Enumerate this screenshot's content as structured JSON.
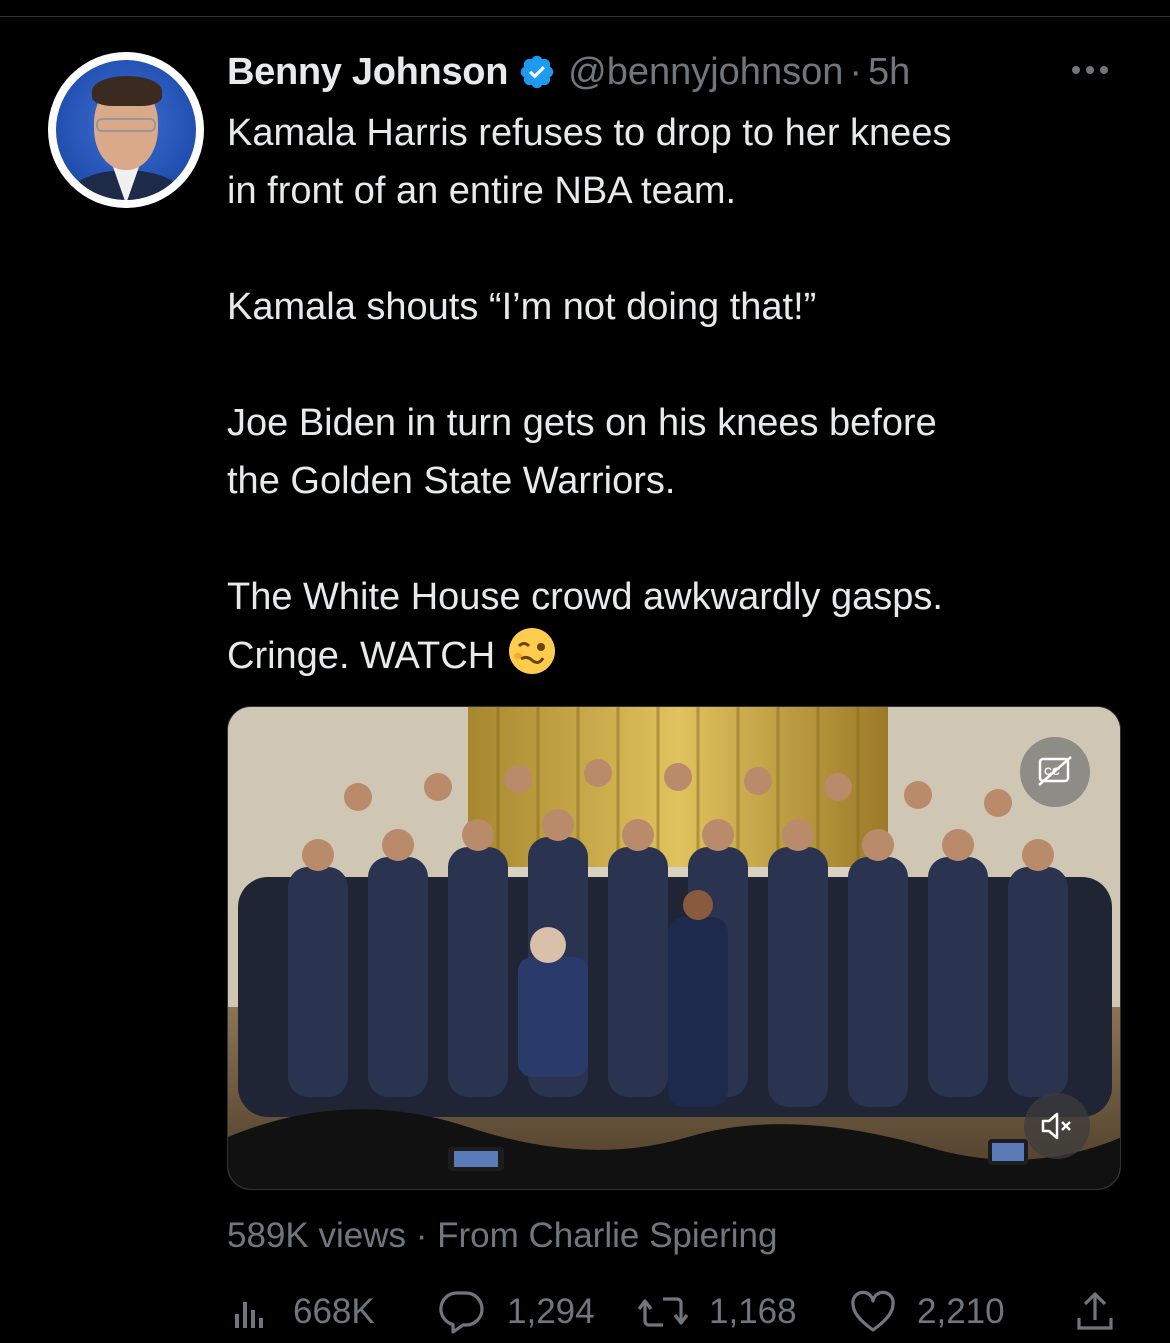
{
  "tweet": {
    "author": {
      "display_name": "Benny Johnson",
      "handle": "@bennyjohnson",
      "verified": true
    },
    "separator": "·",
    "time": "5h",
    "text_lines": [
      "Kamala Harris refuses to drop to her knees",
      "in front of an entire NBA team.",
      "Kamala shouts “I’m not doing that!”",
      "Joe Biden in turn gets on his knees before",
      "the Golden State Warriors.",
      "The White House crowd awkwardly gasps.",
      "Cringe. WATCH"
    ],
    "emoji": "woozy-face",
    "media": {
      "type": "video",
      "captions_icon": "closed-captions-off-icon",
      "mute_icon": "speaker-muted-icon"
    },
    "views_line": "589K views · From Charlie Spiering",
    "stats": {
      "views": "668K",
      "replies": "1,294",
      "retweets": "1,168",
      "likes": "2,210"
    }
  },
  "colors": {
    "background": "#000000",
    "text": "#e7e9ea",
    "muted": "#71767b",
    "verified": "#1d9bf0"
  }
}
